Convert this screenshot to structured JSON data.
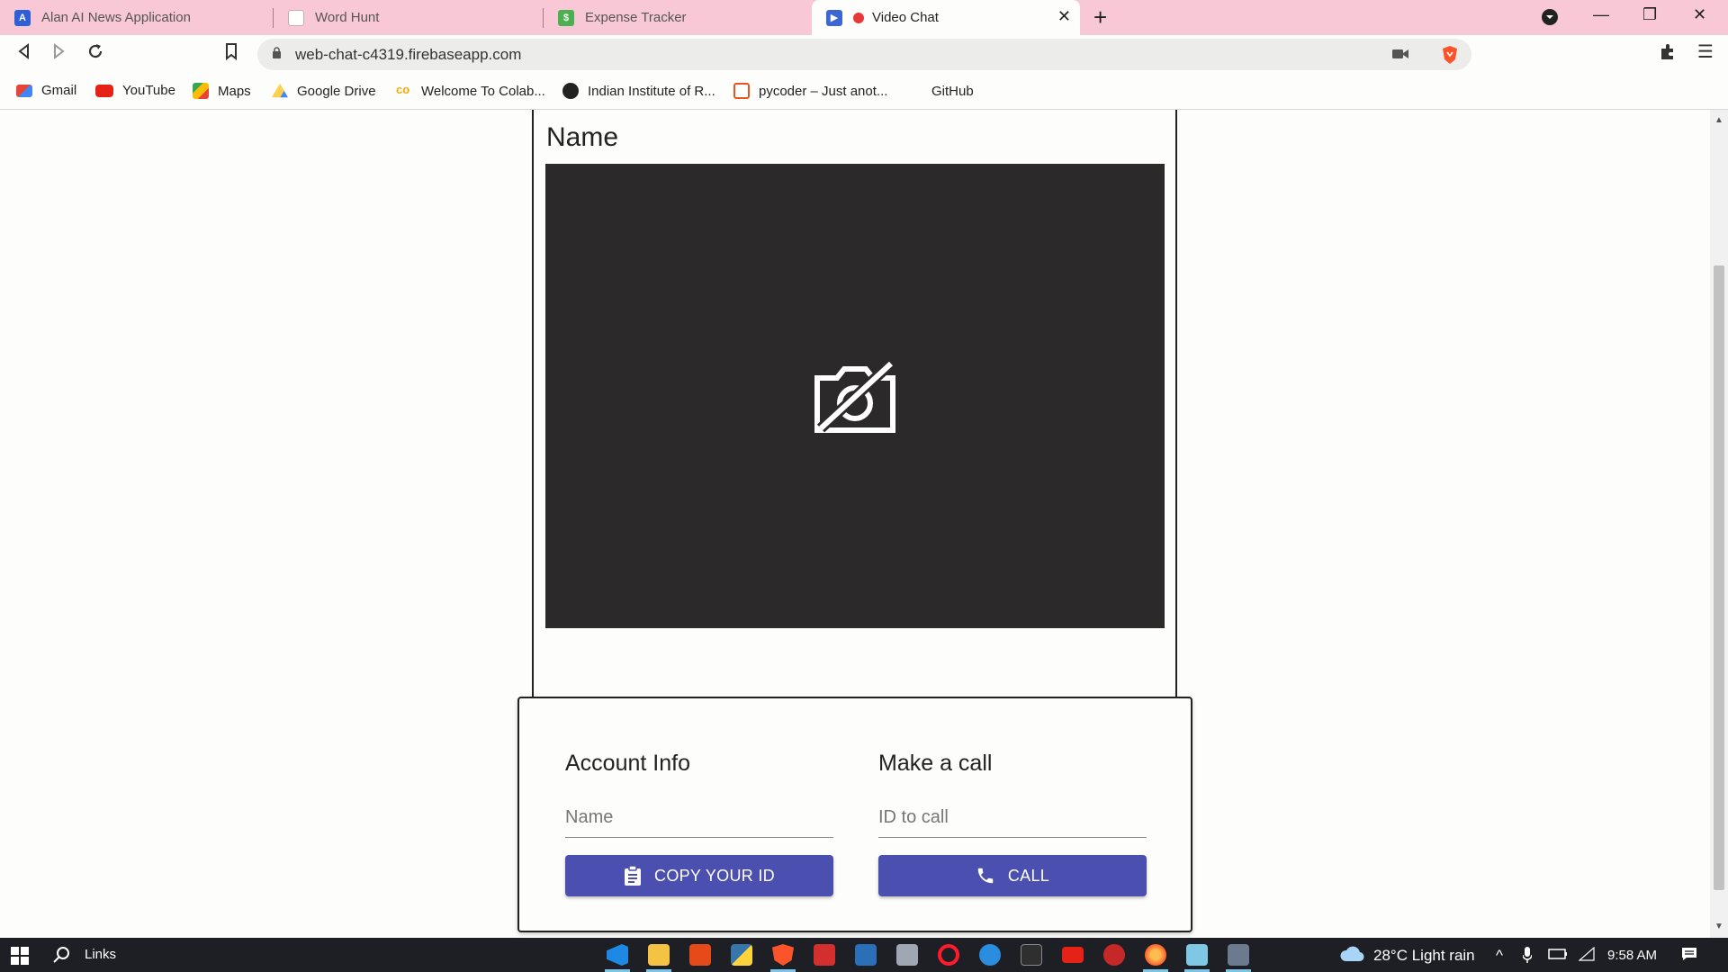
{
  "browser": {
    "tabs": [
      {
        "label": "Alan AI News Application",
        "icon": "alan-ai-icon",
        "color": "#2f5fd6"
      },
      {
        "label": "Word Hunt",
        "icon": "document-icon",
        "color": "#c9a9b2"
      },
      {
        "label": "Expense Tracker",
        "icon": "expense-icon",
        "color": "#4caf50"
      },
      {
        "label": "Video Chat",
        "icon": "video-chat-icon",
        "color": "#3b66d4"
      }
    ],
    "active_tab_index": 3,
    "url": "web-chat-c4319.firebaseapp.com",
    "bookmarks": [
      {
        "label": "Gmail",
        "icon": "gmail-icon"
      },
      {
        "label": "YouTube",
        "icon": "youtube-icon"
      },
      {
        "label": "Maps",
        "icon": "maps-icon"
      },
      {
        "label": "Google Drive",
        "icon": "drive-icon"
      },
      {
        "label": "Welcome To Colab...",
        "icon": "colab-icon"
      },
      {
        "label": "Indian Institute of R...",
        "icon": "globe-icon"
      },
      {
        "label": "pycoder – Just anot...",
        "icon": "pycoder-icon"
      },
      {
        "label": "GitHub",
        "icon": "github-icon"
      }
    ]
  },
  "video": {
    "name_label": "Name",
    "camera_state": "camera-off-icon"
  },
  "account": {
    "title": "Account Info",
    "name_placeholder": "Name",
    "copy_button": "COPY YOUR ID"
  },
  "call": {
    "title": "Make a call",
    "id_placeholder": "ID to call",
    "call_button": "CALL"
  },
  "taskbar": {
    "search_label": "Links",
    "weather": "28°C  Light rain",
    "time": "9:58 AM"
  },
  "colors": {
    "accent": "#4a4fb0",
    "video_bg": "#2b292a",
    "tabstrip": "#f9c8d6"
  }
}
